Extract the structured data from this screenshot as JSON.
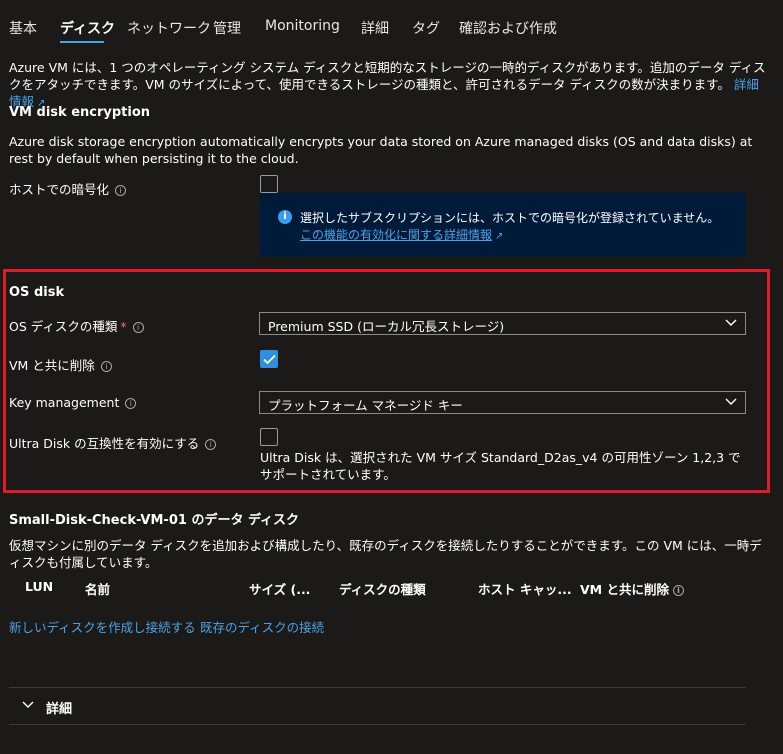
{
  "tabs": [
    {
      "label": "基本",
      "active": false
    },
    {
      "label": "ディスク",
      "active": true
    },
    {
      "label": "ネットワーク",
      "active": false
    },
    {
      "label": "管理",
      "active": false
    },
    {
      "label": "Monitoring",
      "active": false
    },
    {
      "label": "詳細",
      "active": false
    },
    {
      "label": "タグ",
      "active": false
    },
    {
      "label": "確認および作成",
      "active": false
    }
  ],
  "intro": {
    "text": "Azure VM には、1 つのオペレーティング システム ディスクと短期的なストレージの一時的ディスクがあります。追加のデータ ディスクをアタッチできます。VM のサイズによって、使用できるストレージの種類と、許可されるデータ ディスクの数が決まります。",
    "link": "詳細情報"
  },
  "encryption": {
    "heading": "VM disk encryption",
    "description": "Azure disk storage encryption automatically encrypts your data stored on Azure managed disks (OS and data disks) at rest by default when persisting it to the cloud.",
    "host_label": "ホストでの暗号化",
    "host_checked": false,
    "info_text": "選択したサブスクリプションには、ホストでの暗号化が登録されていません。",
    "info_link": "この機能の有効化に関する詳細情報"
  },
  "os_disk": {
    "heading": "OS disk",
    "type_label": "OS ディスクの種類",
    "required_mark": "*",
    "type_value": "Premium SSD (ローカル冗長ストレージ)",
    "delete_label": "VM と共に削除",
    "delete_checked": true,
    "key_label": "Key management",
    "key_value": "プラットフォーム マネージド キー",
    "ultra_label": "Ultra Disk の互換性を有効にする",
    "ultra_checked": false,
    "ultra_note": "Ultra Disk は、選択された VM サイズ Standard_D2as_v4 の可用性ゾーン 1,2,3 でサポートされています。"
  },
  "data_disks": {
    "heading": "Small-Disk-Check-VM-01 のデータ ディスク",
    "description": "仮想マシンに別のデータ ディスクを追加および構成したり、既存のディスクを接続したりすることができます。この VM には、一時ディスクも付属しています。",
    "columns": [
      "LUN",
      "名前",
      "サイズ (...",
      "ディスクの種類",
      "ホスト キャッ...",
      "VM と共に削除"
    ],
    "create_link": "新しいディスクを作成し接続する",
    "attach_link": "既存のディスクの接続"
  },
  "details": {
    "label": "詳細"
  },
  "colors": {
    "background": "#1b1a19",
    "accent": "#2f8ee0",
    "link": "#4aa3e8",
    "highlight_border": "#e0192b",
    "info_background": "#001a3a"
  }
}
